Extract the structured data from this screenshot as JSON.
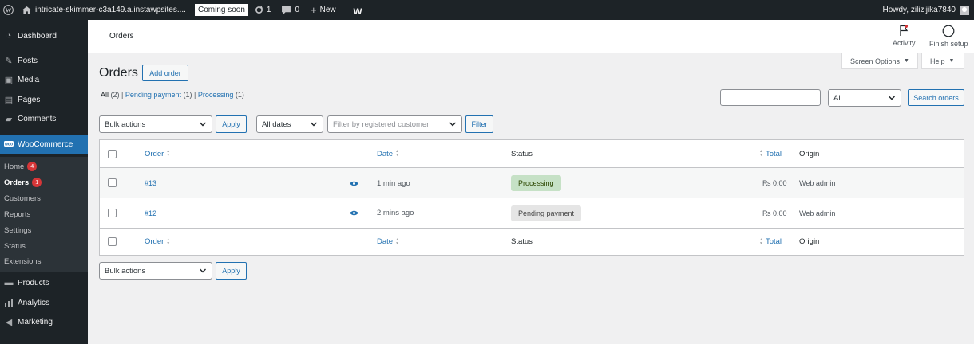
{
  "adminbar": {
    "site_name": "intricate-skimmer-c3a149.a.instawpsites....",
    "coming_soon": "Coming soon",
    "updates": "1",
    "comments": "0",
    "new_label": "New",
    "w_logo": "w",
    "howdy": "Howdy, zilizijika7840"
  },
  "sidebar": {
    "dashboard": "Dashboard",
    "posts": "Posts",
    "media": "Media",
    "pages": "Pages",
    "comments": "Comments",
    "woocommerce": "WooCommerce",
    "sub": {
      "home": "Home",
      "home_count": "4",
      "orders": "Orders",
      "orders_count": "1",
      "customers": "Customers",
      "reports": "Reports",
      "settings": "Settings",
      "status": "Status",
      "extensions": "Extensions"
    },
    "products": "Products",
    "analytics": "Analytics",
    "marketing": "Marketing"
  },
  "header": {
    "breadcrumb": "Orders",
    "activity": "Activity",
    "finish_setup": "Finish setup",
    "screen_options": "Screen Options",
    "help": "Help"
  },
  "main": {
    "title": "Orders",
    "add_order": "Add order",
    "views": {
      "all": "All",
      "all_count": "(2)",
      "pending": "Pending payment",
      "pending_count": "(1)",
      "processing": "Processing",
      "processing_count": "(1)",
      "sep": "|"
    },
    "search": {
      "value": "",
      "status_select": "All",
      "button": "Search orders"
    },
    "top_filters": {
      "bulk_actions": "Bulk actions",
      "apply": "Apply",
      "all_dates": "All dates",
      "customer_placeholder": "Filter by registered customer",
      "filter": "Filter"
    },
    "columns": {
      "order": "Order",
      "date": "Date",
      "status": "Status",
      "total": "Total",
      "origin": "Origin"
    },
    "rows": [
      {
        "order": "#13",
        "date": "1 min ago",
        "status": "Processing",
        "total": "₨ 0.00",
        "origin": "Web admin"
      },
      {
        "order": "#12",
        "date": "2 mins ago",
        "status": "Pending payment",
        "total": "₨ 0.00",
        "origin": "Web admin"
      }
    ],
    "bottom_filters": {
      "bulk_actions": "Bulk actions",
      "apply": "Apply"
    }
  },
  "colors": {
    "admin_dark": "#1d2327",
    "accent": "#2271b1",
    "processing_bg": "#c6e1c6",
    "pending_bg": "#e5e5e5",
    "badge_red": "#d63638"
  }
}
